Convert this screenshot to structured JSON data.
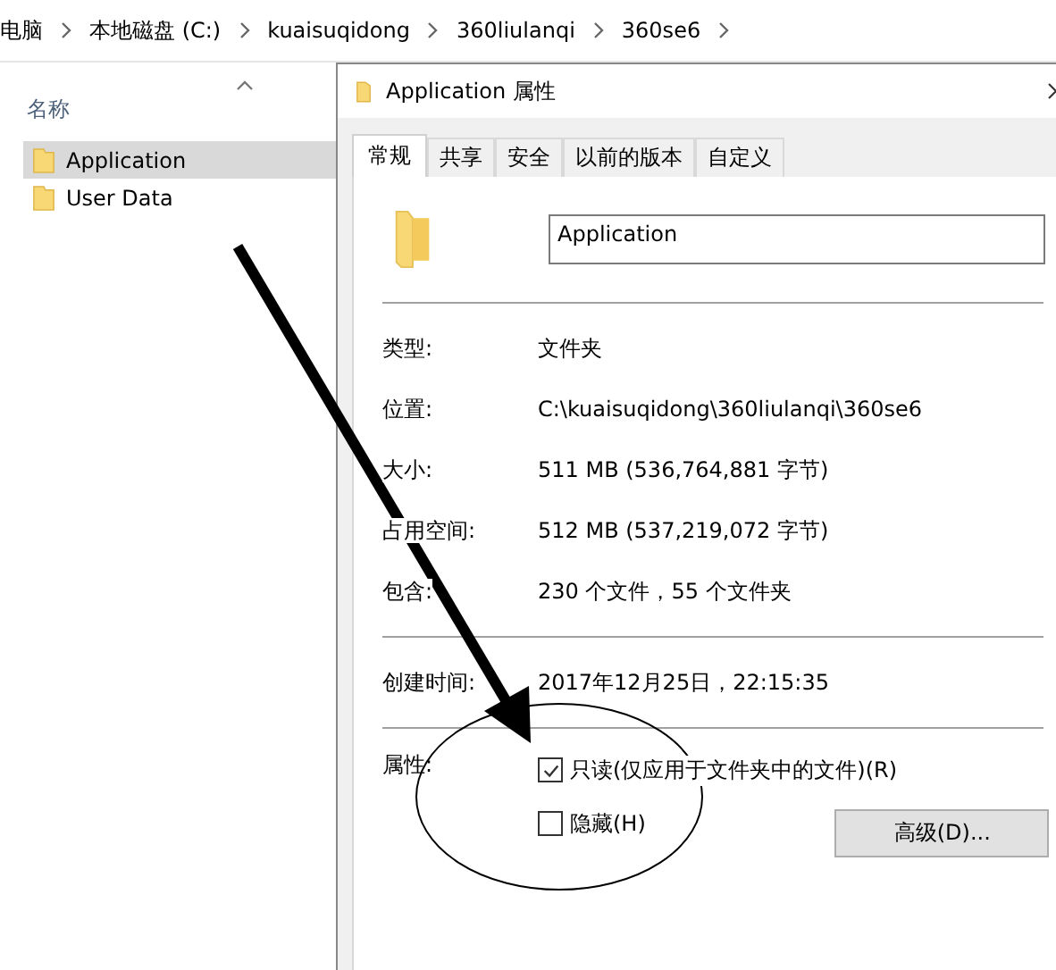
{
  "breadcrumb": [
    "电脑",
    "本地磁盘 (C:)",
    "kuaisuqidong",
    "360liulanqi",
    "360se6"
  ],
  "file_list": {
    "column_header": "名称",
    "items": [
      {
        "name": "Application",
        "selected": true
      },
      {
        "name": "User Data",
        "selected": false
      }
    ]
  },
  "dialog": {
    "title": "Application 属性",
    "tabs": [
      {
        "label": "常规",
        "selected": true
      },
      {
        "label": "共享",
        "selected": false
      },
      {
        "label": "安全",
        "selected": false
      },
      {
        "label": "以前的版本",
        "selected": false
      },
      {
        "label": "自定义",
        "selected": false
      }
    ],
    "name_field": {
      "value": "Application"
    },
    "info_groups": [
      [
        {
          "label": "类型:",
          "value": "文件夹"
        },
        {
          "label": "位置:",
          "value": "C:\\kuaisuqidong\\360liulanqi\\360se6"
        },
        {
          "label": "大小:",
          "value": "511 MB (536,764,881 字节)"
        },
        {
          "label": "占用空间:",
          "value": "512 MB (537,219,072 字节)"
        },
        {
          "label": "包含:",
          "value": "230 个文件，55 个文件夹"
        }
      ],
      [
        {
          "label": "创建时间:",
          "value": "2017年12月25日，22:15:35"
        }
      ]
    ],
    "attributes": {
      "label": "属性:",
      "checkboxes": [
        {
          "label": "只读(仅应用于文件夹中的文件)(R)",
          "checked": true
        },
        {
          "label": "隐藏(H)",
          "checked": false
        }
      ],
      "advanced_button": "高级(D)..."
    }
  }
}
